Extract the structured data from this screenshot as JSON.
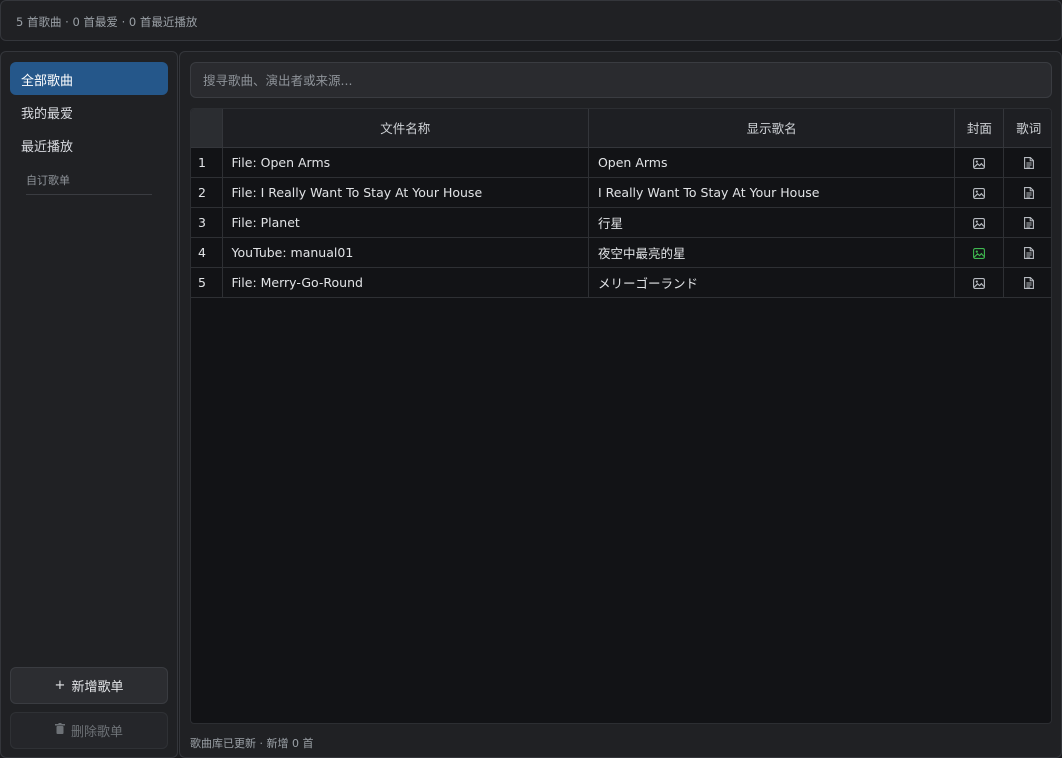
{
  "topbar": {
    "stats": "5 首歌曲 · 0 首最爱 · 0 首最近播放"
  },
  "sidebar": {
    "items": [
      {
        "label": "全部歌曲",
        "active": true
      },
      {
        "label": "我的最爱",
        "active": false
      },
      {
        "label": "最近播放",
        "active": false
      }
    ],
    "custom_header": "自订歌单",
    "add_label": "新增歌单",
    "delete_label": "删除歌单"
  },
  "search": {
    "placeholder": "搜寻歌曲、演出者或来源..."
  },
  "table": {
    "headers": {
      "file": "文件名称",
      "title": "显示歌名",
      "cover": "封面",
      "lyrics": "歌词"
    },
    "rows": [
      {
        "index": "1",
        "file": "File: Open Arms",
        "title": "Open Arms",
        "cover": "image-icon",
        "lyrics": "document-icon"
      },
      {
        "index": "2",
        "file": "File: I Really Want To Stay At Your House",
        "title": "I Really Want To Stay At Your House",
        "cover": "image-icon",
        "lyrics": "document-icon"
      },
      {
        "index": "3",
        "file": "File: Planet",
        "title": "行星",
        "cover": "image-icon",
        "lyrics": "document-icon"
      },
      {
        "index": "4",
        "file": "YouTube: manual01",
        "title": "夜空中最亮的星",
        "cover": "image-icon-green",
        "lyrics": "document-icon"
      },
      {
        "index": "5",
        "file": "File: Merry-Go-Round",
        "title": "メリーゴーランド",
        "cover": "image-icon",
        "lyrics": "document-icon"
      }
    ]
  },
  "status": "歌曲库已更新 · 新增 0 首",
  "colors": {
    "accent": "#25578a",
    "cover_present": "#3fb950",
    "icon_default": "#b8bcc2"
  }
}
